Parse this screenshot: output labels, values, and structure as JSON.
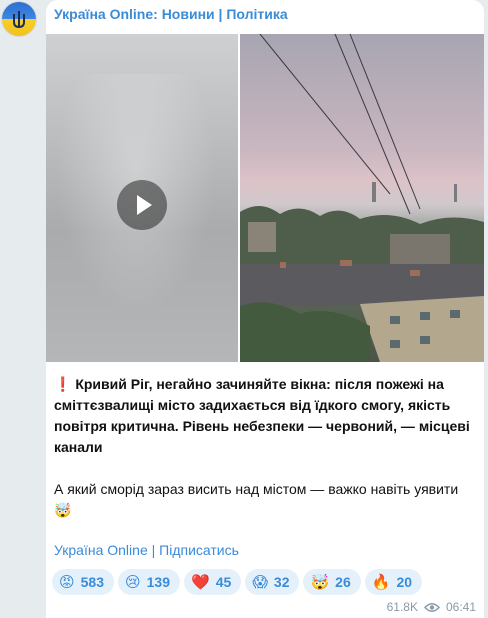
{
  "channel": {
    "title": "Україна Online: Новини | Політика"
  },
  "post": {
    "alert_icon": "❗",
    "text_bold": "Кривий Ріг, негайно зачиняйте вікна: після пожежі на сміттєзвалищі місто задихається від їдкого смогу, якість повітря критична. Рівень небезпеки — червоний, — місцеві канали",
    "text_plain": "А який сморід зараз висить над містом — важко навіть уявити",
    "trailing_emoji": "🤯",
    "subscribe_link": "Україна Online | Підписатись"
  },
  "reactions": [
    {
      "emoji": "😡",
      "count": "583"
    },
    {
      "emoji": "😢",
      "count": "139"
    },
    {
      "emoji": "❤️",
      "count": "45"
    },
    {
      "emoji": "😱",
      "count": "32"
    },
    {
      "emoji": "🤯",
      "count": "26"
    },
    {
      "emoji": "🔥",
      "count": "20"
    }
  ],
  "meta": {
    "views": "61.8K",
    "time": "06:41",
    "views_icon": "eye-icon"
  },
  "colors": {
    "accent": "#3a8bd8",
    "bubble": "#ffffff",
    "background": "#e6ebee",
    "reaction_bg": "#e4f1fb",
    "alert": "#e0262b"
  }
}
